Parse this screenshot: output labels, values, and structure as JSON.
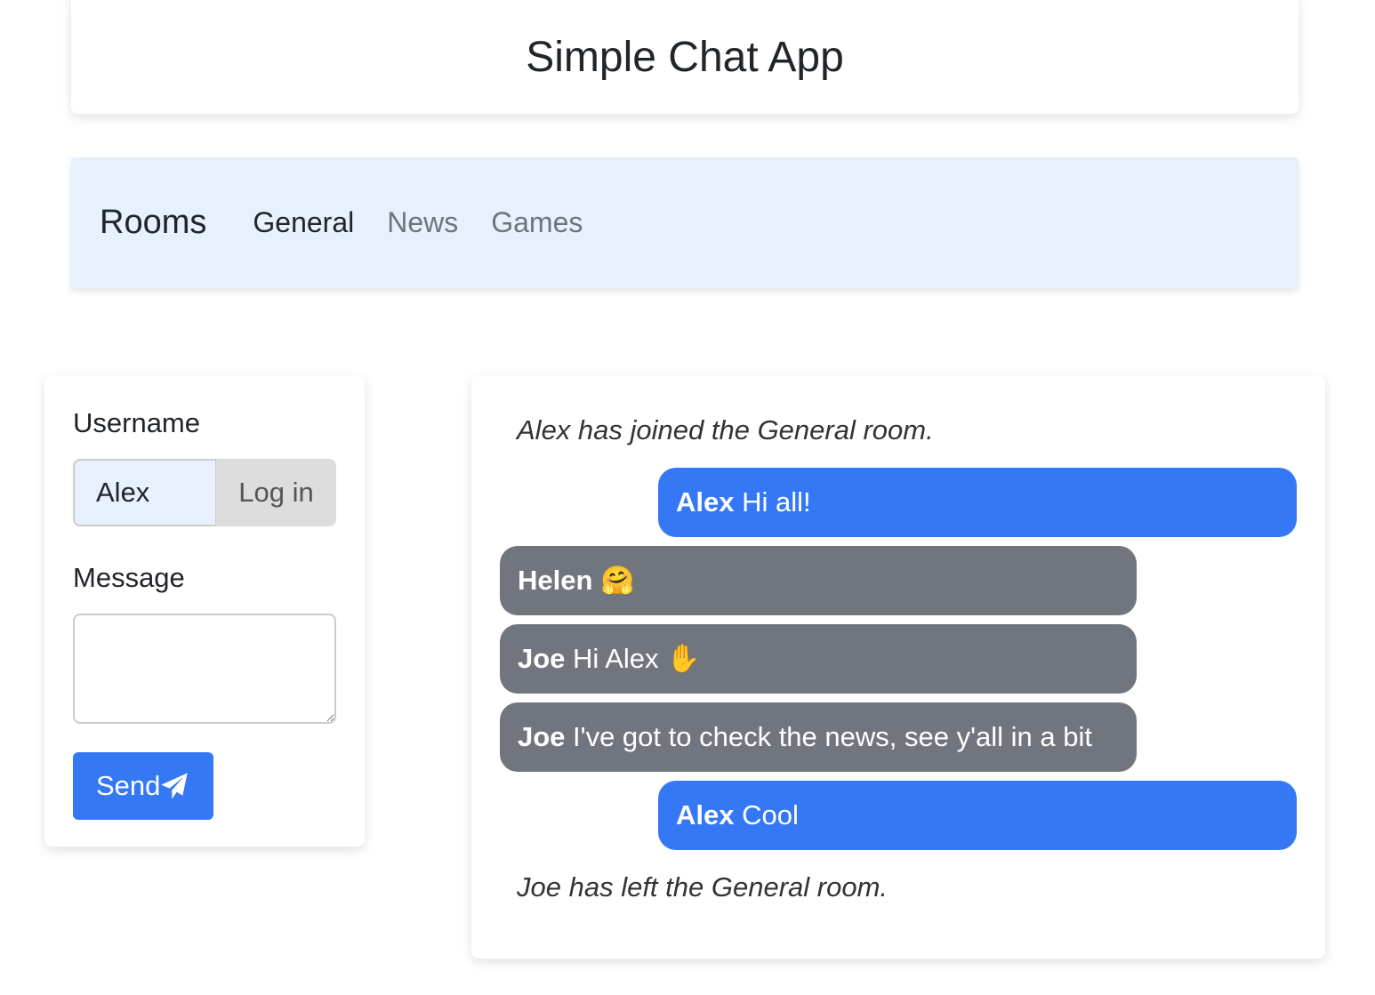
{
  "header": {
    "title": "Simple Chat App"
  },
  "rooms": {
    "brand": "Rooms",
    "items": [
      {
        "label": "General",
        "active": true
      },
      {
        "label": "News",
        "active": false
      },
      {
        "label": "Games",
        "active": false
      }
    ]
  },
  "form": {
    "username_label": "Username",
    "username_value": "Alex",
    "login_label": "Log in",
    "message_label": "Message",
    "message_value": "",
    "send_label": "Send",
    "send_icon": "paper-plane-icon"
  },
  "chat": {
    "joined": "Alex has joined the General room.",
    "messages": [
      {
        "user": "Alex",
        "text": "Hi all!",
        "own": true
      },
      {
        "user": "Helen",
        "text": "🤗",
        "own": false
      },
      {
        "user": "Joe",
        "text": "Hi Alex ✋",
        "own": false
      },
      {
        "user": "Joe",
        "text": "I've got to check the news, see y'all in a bit",
        "own": false
      },
      {
        "user": "Alex",
        "text": "Cool",
        "own": true
      }
    ],
    "left": "Joe has left the General room."
  },
  "colors": {
    "own_bubble": "#3478f6",
    "other_bubble": "#71767e",
    "navbar": "#e7f1fb"
  }
}
